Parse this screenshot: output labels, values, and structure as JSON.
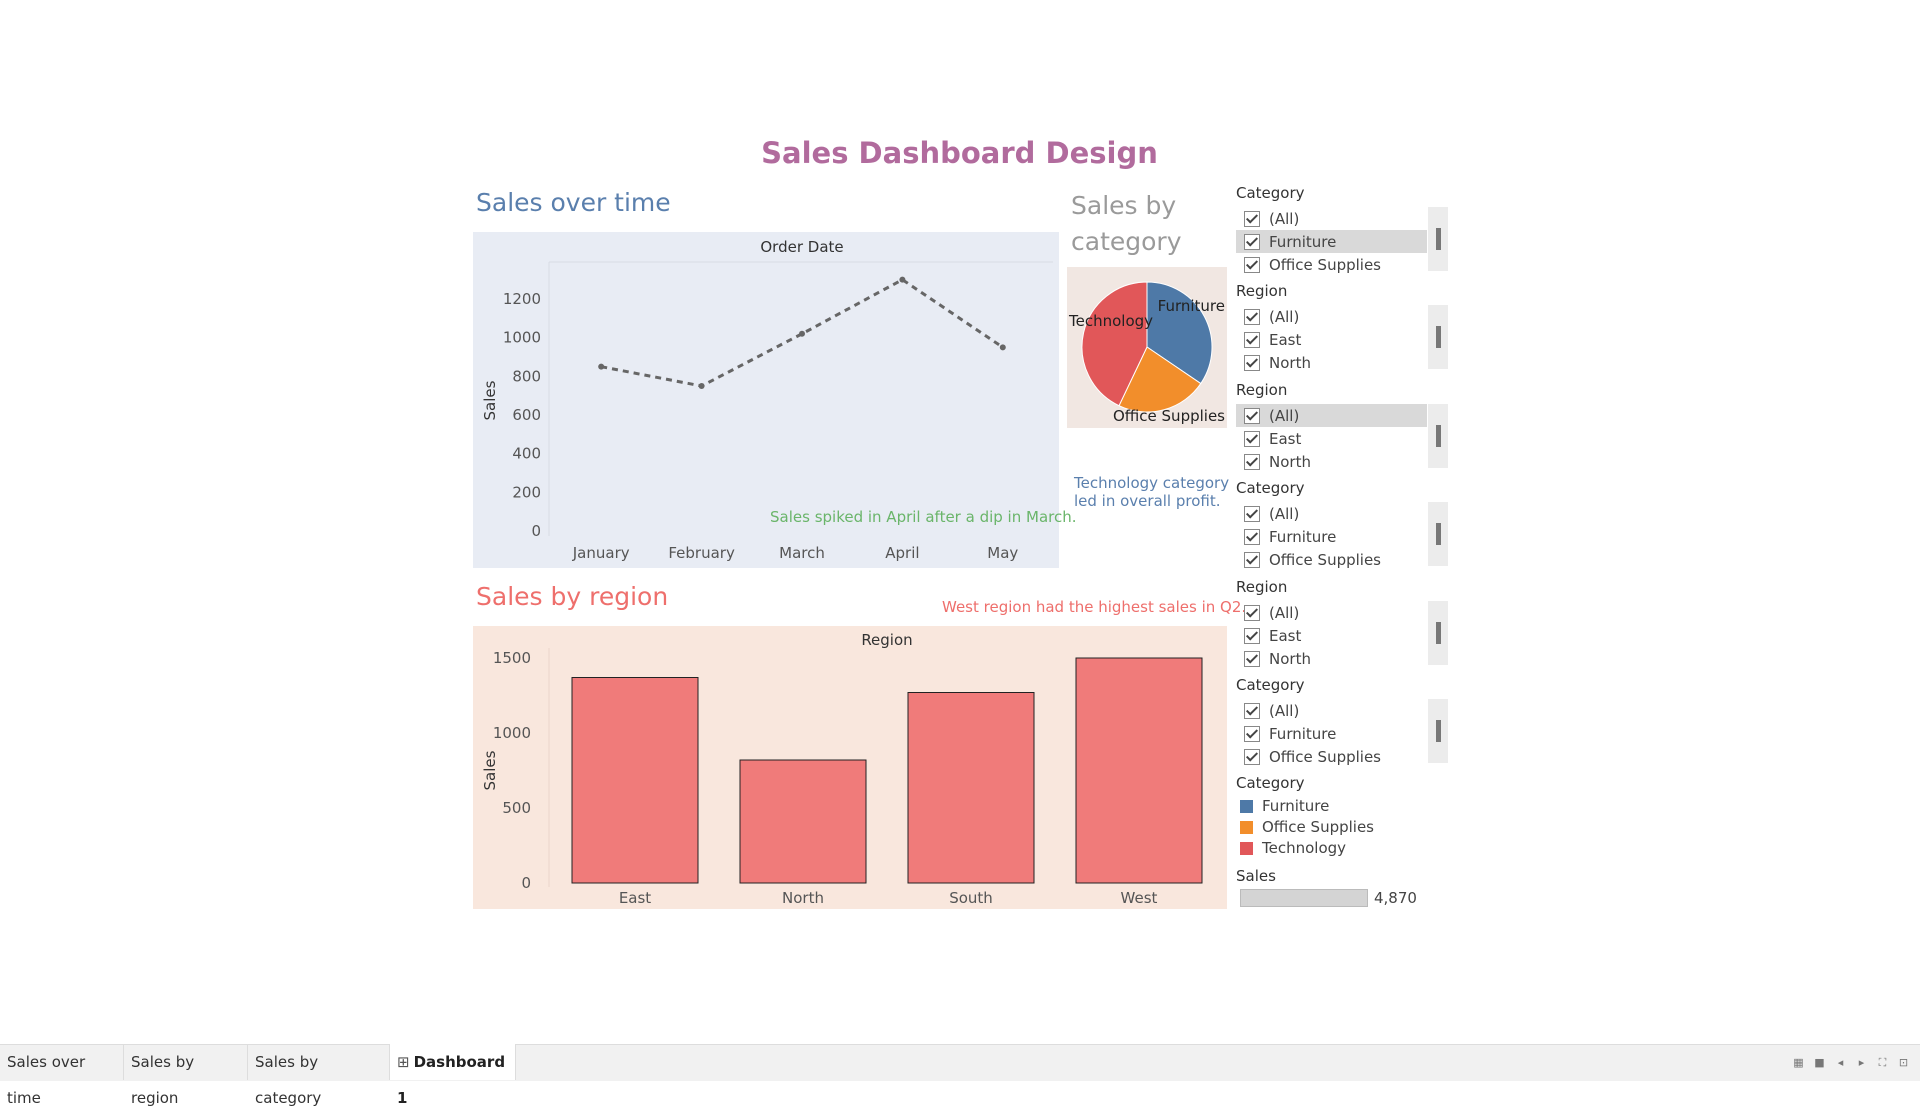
{
  "dashboard": {
    "title": "Sales Dashboard Design"
  },
  "sales_over_time": {
    "title": "Sales over time",
    "annotation": "Sales spiked in April after a dip in March."
  },
  "sales_by_region": {
    "title": "Sales by region",
    "annotation": "West region had the highest sales in Q2."
  },
  "sales_by_category": {
    "title": "Sales by category",
    "annotation": "Technology category led in overall profit."
  },
  "filters": [
    {
      "header": "Category",
      "items": [
        "(All)",
        "Furniture",
        "Office Supplies"
      ],
      "selected": 1
    },
    {
      "header": "Region",
      "items": [
        "(All)",
        "East",
        "North"
      ],
      "selected": -1
    },
    {
      "header": "Region",
      "items": [
        "(All)",
        "East",
        "North"
      ],
      "selected": 0
    },
    {
      "header": "Category",
      "items": [
        "(All)",
        "Furniture",
        "Office Supplies"
      ],
      "selected": -1
    },
    {
      "header": "Region",
      "items": [
        "(All)",
        "East",
        "North"
      ],
      "selected": -1
    },
    {
      "header": "Category",
      "items": [
        "(All)",
        "Furniture",
        "Office Supplies"
      ],
      "selected": -1
    }
  ],
  "color_legend": {
    "header": "Category",
    "items": [
      {
        "label": "Furniture",
        "color": "#4e79a7"
      },
      {
        "label": "Office Supplies",
        "color": "#f28e2b"
      },
      {
        "label": "Technology",
        "color": "#e15759"
      }
    ]
  },
  "size_legend": {
    "header": "Sales",
    "value": "4,870"
  },
  "tabs": [
    {
      "label": "Sales over time",
      "active": false
    },
    {
      "label": "Sales by region",
      "active": false
    },
    {
      "label": "Sales by category",
      "active": false
    },
    {
      "label": "Dashboard 1",
      "active": true,
      "icon": "grid-icon"
    }
  ],
  "chart_data": [
    {
      "type": "line",
      "title": "Order Date",
      "xlabel": "",
      "ylabel": "Sales",
      "categories": [
        "January",
        "February",
        "March",
        "April",
        "May"
      ],
      "values": [
        850,
        750,
        1020,
        1300,
        950
      ],
      "yticks": [
        0,
        200,
        400,
        600,
        800,
        1000,
        1200
      ],
      "ylim": [
        0,
        1350
      ],
      "line_style": "dashed",
      "color": "#666666"
    },
    {
      "type": "bar",
      "title": "Region",
      "xlabel": "",
      "ylabel": "Sales",
      "categories": [
        "East",
        "North",
        "South",
        "West"
      ],
      "values": [
        1370,
        820,
        1270,
        1500
      ],
      "yticks": [
        0,
        500,
        1000,
        1500
      ],
      "ylim": [
        0,
        1500
      ],
      "color": "#f07b7a"
    },
    {
      "type": "pie",
      "title": "",
      "categories": [
        "Furniture",
        "Office Supplies",
        "Technology"
      ],
      "values": [
        1680,
        1100,
        2090
      ],
      "colors": [
        "#4e79a7",
        "#f28e2b",
        "#e15759"
      ]
    }
  ]
}
